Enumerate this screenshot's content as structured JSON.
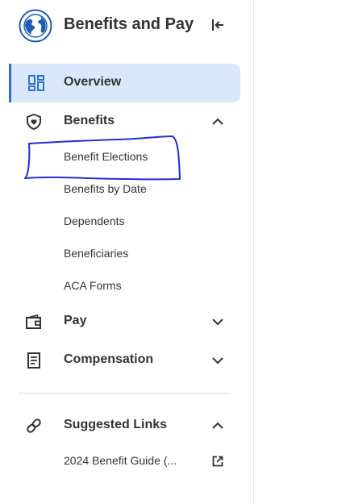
{
  "header": {
    "title": "Benefits and Pay",
    "logo_icon": "globe-icon",
    "collapse_icon": "collapse-sidebar-icon"
  },
  "nav": {
    "overview": {
      "label": "Overview",
      "icon": "dashboard-icon",
      "active": true
    },
    "benefits": {
      "label": "Benefits",
      "icon": "shield-heart-icon",
      "expanded": true,
      "items": [
        {
          "label": "Benefit Elections"
        },
        {
          "label": "Benefits by Date"
        },
        {
          "label": "Dependents"
        },
        {
          "label": "Beneficiaries"
        },
        {
          "label": "ACA Forms"
        }
      ]
    },
    "pay": {
      "label": "Pay",
      "icon": "wallet-icon",
      "expanded": false
    },
    "compensation": {
      "label": "Compensation",
      "icon": "document-icon",
      "expanded": false
    },
    "suggested_links": {
      "label": "Suggested Links",
      "icon": "link-icon",
      "expanded": true,
      "items": [
        {
          "label": "2024 Benefit Guide (...",
          "icon": "external-link-icon"
        }
      ]
    }
  },
  "colors": {
    "accent": "#2d71d6",
    "active_bg": "#d9e8fb",
    "logo_blue": "#1f5db5",
    "annotation": "#1e2fd6"
  }
}
